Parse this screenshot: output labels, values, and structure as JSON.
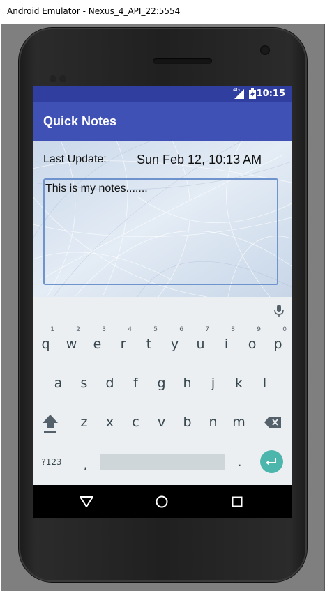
{
  "window": {
    "title": "Android Emulator - Nexus_4_API_22:5554"
  },
  "status_bar": {
    "time": "10:15",
    "network": "4G",
    "icons": [
      "signal-icon",
      "battery-charging-icon"
    ]
  },
  "app": {
    "title": "Quick Notes"
  },
  "content": {
    "last_update_label": "Last Update:",
    "last_update_value": "Sun Feb 12, 10:13 AM",
    "notes_value": "This is  my notes......."
  },
  "keyboard": {
    "row1": [
      {
        "key": "q",
        "hint": "1"
      },
      {
        "key": "w",
        "hint": "2"
      },
      {
        "key": "e",
        "hint": "3"
      },
      {
        "key": "r",
        "hint": "4"
      },
      {
        "key": "t",
        "hint": "5"
      },
      {
        "key": "y",
        "hint": "6"
      },
      {
        "key": "u",
        "hint": "7"
      },
      {
        "key": "i",
        "hint": "8"
      },
      {
        "key": "o",
        "hint": "9"
      },
      {
        "key": "p",
        "hint": "0"
      }
    ],
    "row2": [
      "a",
      "s",
      "d",
      "f",
      "g",
      "h",
      "j",
      "k",
      "l"
    ],
    "row3": [
      "z",
      "x",
      "c",
      "v",
      "b",
      "n",
      "m"
    ],
    "symbols_label": "?123",
    "comma_label": ",",
    "period_label": ".",
    "icons": [
      "shift-icon",
      "backspace-icon",
      "mic-icon",
      "enter-icon"
    ]
  },
  "nav_bar": {
    "icons": [
      "back-icon",
      "home-icon",
      "recents-icon"
    ]
  },
  "colors": {
    "status_bar": "#303f9f",
    "toolbar": "#3f51b5",
    "note_border": "#6f93cc",
    "enter_key": "#4db6ac",
    "keyboard_bg": "#eceff1"
  }
}
